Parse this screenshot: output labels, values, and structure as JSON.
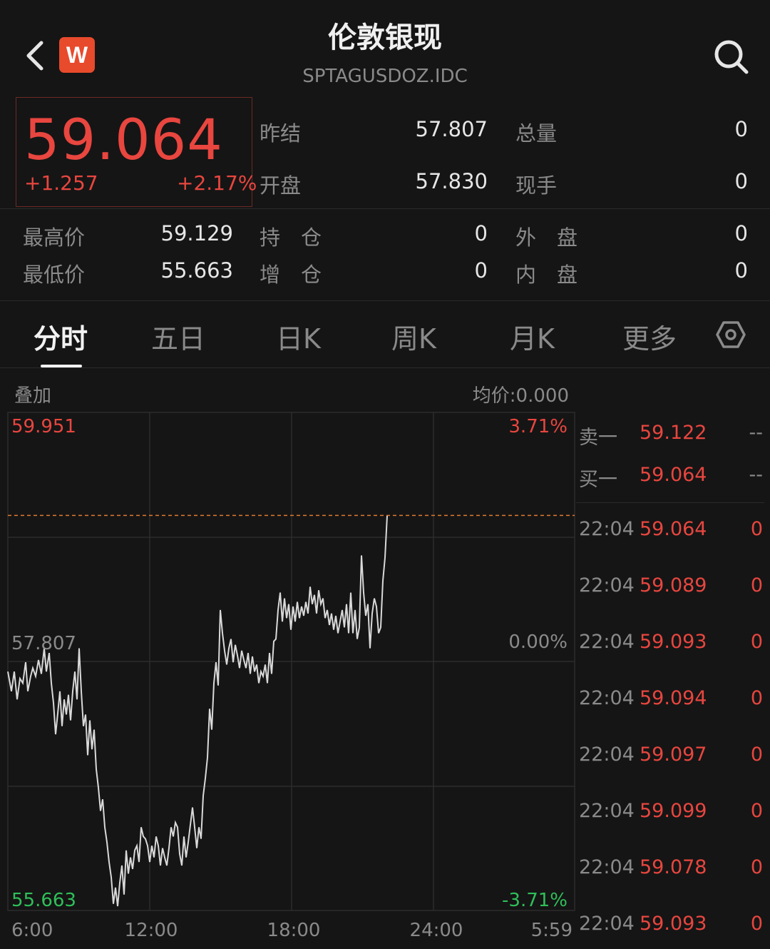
{
  "header": {
    "title": "伦敦银现",
    "code": "SPTAGUSDOZ.IDC",
    "logo_text": "W",
    "back_icon": "chevron-left-icon",
    "search_icon": "search-icon"
  },
  "quote": {
    "last": "59.064",
    "change": "+1.257",
    "change_pct": "+2.17%",
    "fields": [
      {
        "label": "昨结",
        "value": "57.807"
      },
      {
        "label": "总量",
        "value": "0"
      },
      {
        "label": "开盘",
        "value": "57.830"
      },
      {
        "label": "现手",
        "value": "0"
      },
      {
        "label": "最高价",
        "value": "59.129"
      },
      {
        "label": "持　仓",
        "value": "0"
      },
      {
        "label": "外　盘",
        "value": "0"
      },
      {
        "label": "最低价",
        "value": "55.663"
      },
      {
        "label": "增　仓",
        "value": "0"
      },
      {
        "label": "内　盘",
        "value": "0"
      }
    ]
  },
  "tabs": [
    {
      "label": "分时",
      "active": true
    },
    {
      "label": "五日"
    },
    {
      "label": "日K"
    },
    {
      "label": "周K"
    },
    {
      "label": "月K"
    },
    {
      "label": "更多"
    }
  ],
  "settings_icon": "hexagon-settings-icon",
  "chart_header": {
    "overlay": "叠加",
    "avg_price": "均价:0.000"
  },
  "chart_data": {
    "type": "line",
    "y_labels": {
      "top": "59.951",
      "mid": "57.807",
      "bottom": "55.663"
    },
    "pct_labels": {
      "top": "3.71%",
      "mid": "0.00%",
      "bottom": "-3.71%"
    },
    "x_ticks": [
      "6:00",
      "12:00",
      "18:00",
      "24:00",
      "5:59"
    ],
    "ylim": [
      55.663,
      59.951
    ],
    "prev_close": 57.807,
    "current": 59.064,
    "line_color": "#d9d9d9",
    "ref_line_color": "#e07a30",
    "points": [
      [
        0,
        57.72
      ],
      [
        5,
        57.55
      ],
      [
        9,
        57.72
      ],
      [
        13,
        57.48
      ],
      [
        17,
        57.66
      ],
      [
        21,
        57.62
      ],
      [
        25,
        57.8
      ],
      [
        28,
        57.55
      ],
      [
        32,
        57.68
      ],
      [
        35,
        57.75
      ],
      [
        39,
        57.68
      ],
      [
        43,
        57.82
      ],
      [
        47,
        57.7
      ],
      [
        51,
        57.92
      ],
      [
        54,
        57.72
      ],
      [
        58,
        57.88
      ],
      [
        61,
        57.62
      ],
      [
        64,
        57.45
      ],
      [
        67,
        57.18
      ],
      [
        70,
        57.36
      ],
      [
        73,
        57.55
      ],
      [
        76,
        57.25
      ],
      [
        79,
        57.48
      ],
      [
        82,
        57.35
      ],
      [
        85,
        57.52
      ],
      [
        88,
        57.3
      ],
      [
        91,
        57.55
      ],
      [
        94,
        57.72
      ],
      [
        97,
        57.48
      ],
      [
        100,
        57.92
      ],
      [
        103,
        57.55
      ],
      [
        106,
        57.25
      ],
      [
        109,
        57.35
      ],
      [
        112,
        57.0
      ],
      [
        115,
        57.3
      ],
      [
        118,
        57.05
      ],
      [
        121,
        57.22
      ],
      [
        124,
        56.88
      ],
      [
        127,
        56.72
      ],
      [
        130,
        56.52
      ],
      [
        133,
        56.62
      ],
      [
        136,
        56.38
      ],
      [
        139,
        56.25
      ],
      [
        142,
        56.08
      ],
      [
        145,
        55.95
      ],
      [
        148,
        55.72
      ],
      [
        151,
        55.86
      ],
      [
        154,
        55.7
      ],
      [
        157,
        55.9
      ],
      [
        160,
        56.05
      ],
      [
        163,
        55.8
      ],
      [
        166,
        56.18
      ],
      [
        169,
        55.98
      ],
      [
        172,
        56.12
      ],
      [
        175,
        56.02
      ],
      [
        178,
        56.18
      ],
      [
        181,
        56.22
      ],
      [
        184,
        56.08
      ],
      [
        187,
        56.38
      ],
      [
        190,
        56.3
      ],
      [
        193,
        56.28
      ],
      [
        196,
        56.22
      ],
      [
        199,
        56.08
      ],
      [
        202,
        56.22
      ],
      [
        205,
        56.12
      ],
      [
        208,
        56.3
      ],
      [
        211,
        56.22
      ],
      [
        214,
        56.05
      ],
      [
        217,
        56.2
      ],
      [
        220,
        56.12
      ],
      [
        223,
        56.05
      ],
      [
        226,
        56.2
      ],
      [
        229,
        56.38
      ],
      [
        232,
        56.3
      ],
      [
        235,
        56.42
      ],
      [
        238,
        56.38
      ],
      [
        241,
        56.15
      ],
      [
        244,
        56.05
      ],
      [
        247,
        56.3
      ],
      [
        250,
        56.12
      ],
      [
        253,
        56.25
      ],
      [
        256,
        56.4
      ],
      [
        259,
        56.55
      ],
      [
        262,
        56.38
      ],
      [
        265,
        56.2
      ],
      [
        268,
        56.38
      ],
      [
        271,
        56.28
      ],
      [
        274,
        56.65
      ],
      [
        277,
        56.8
      ],
      [
        280,
        56.98
      ],
      [
        283,
        57.4
      ],
      [
        286,
        57.22
      ],
      [
        289,
        57.62
      ],
      [
        292,
        57.8
      ],
      [
        295,
        57.6
      ],
      [
        298,
        58.25
      ],
      [
        301,
        58.05
      ],
      [
        304,
        57.9
      ],
      [
        307,
        57.78
      ],
      [
        310,
        57.92
      ],
      [
        313,
        58.0
      ],
      [
        316,
        57.8
      ],
      [
        319,
        57.95
      ],
      [
        322,
        57.86
      ],
      [
        325,
        57.75
      ],
      [
        328,
        57.9
      ],
      [
        331,
        57.82
      ],
      [
        334,
        57.75
      ],
      [
        337,
        57.88
      ],
      [
        340,
        57.7
      ],
      [
        343,
        57.85
      ],
      [
        346,
        57.72
      ],
      [
        349,
        57.78
      ],
      [
        352,
        57.62
      ],
      [
        355,
        57.72
      ],
      [
        358,
        57.68
      ],
      [
        361,
        57.78
      ],
      [
        364,
        57.62
      ],
      [
        367,
        57.88
      ],
      [
        370,
        57.7
      ],
      [
        373,
        57.98
      ],
      [
        376,
        58.0
      ],
      [
        379,
        58.25
      ],
      [
        382,
        58.4
      ],
      [
        385,
        58.15
      ],
      [
        388,
        58.35
      ],
      [
        391,
        58.18
      ],
      [
        394,
        58.3
      ],
      [
        397,
        58.08
      ],
      [
        400,
        58.28
      ],
      [
        403,
        58.15
      ],
      [
        406,
        58.32
      ],
      [
        409,
        58.18
      ],
      [
        412,
        58.28
      ],
      [
        415,
        58.2
      ],
      [
        418,
        58.32
      ],
      [
        421,
        58.22
      ],
      [
        424,
        58.45
      ],
      [
        427,
        58.3
      ],
      [
        430,
        58.38
      ],
      [
        433,
        58.22
      ],
      [
        436,
        58.42
      ],
      [
        439,
        58.3
      ],
      [
        442,
        58.35
      ],
      [
        445,
        58.18
      ],
      [
        448,
        58.25
      ],
      [
        451,
        58.12
      ],
      [
        454,
        58.22
      ],
      [
        457,
        58.08
      ],
      [
        460,
        58.2
      ],
      [
        463,
        58.05
      ],
      [
        466,
        58.15
      ],
      [
        469,
        58.25
      ],
      [
        472,
        58.1
      ],
      [
        475,
        58.3
      ],
      [
        478,
        58.05
      ],
      [
        481,
        58.4
      ],
      [
        484,
        58.05
      ],
      [
        487,
        58.25
      ],
      [
        490,
        58.0
      ],
      [
        493,
        58.1
      ],
      [
        496,
        58.72
      ],
      [
        499,
        58.4
      ],
      [
        502,
        58.2
      ],
      [
        505,
        58.3
      ],
      [
        508,
        57.92
      ],
      [
        511,
        58.22
      ],
      [
        514,
        58.35
      ],
      [
        517,
        58.28
      ],
      [
        520,
        58.05
      ],
      [
        523,
        58.1
      ],
      [
        526,
        58.5
      ],
      [
        529,
        58.7
      ],
      [
        532,
        59.06
      ]
    ]
  },
  "order_book": {
    "sell": {
      "label": "卖一",
      "price": "59.122",
      "vol": "--"
    },
    "buy": {
      "label": "买一",
      "price": "59.064",
      "vol": "--"
    },
    "trades": [
      {
        "time": "22:04",
        "price": "59.064",
        "vol": "0"
      },
      {
        "time": "22:04",
        "price": "59.089",
        "vol": "0"
      },
      {
        "time": "22:04",
        "price": "59.093",
        "vol": "0"
      },
      {
        "time": "22:04",
        "price": "59.094",
        "vol": "0"
      },
      {
        "time": "22:04",
        "price": "59.097",
        "vol": "0"
      },
      {
        "time": "22:04",
        "price": "59.099",
        "vol": "0"
      },
      {
        "time": "22:04",
        "price": "59.078",
        "vol": "0"
      },
      {
        "time": "22:04",
        "price": "59.093",
        "vol": "0"
      }
    ]
  }
}
